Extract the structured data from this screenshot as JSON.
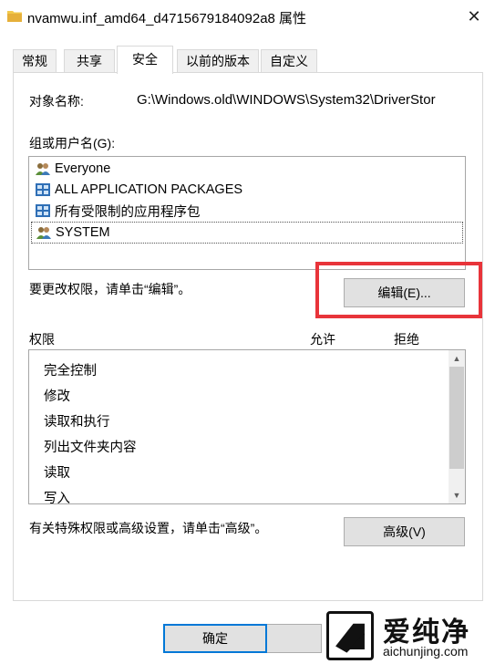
{
  "window": {
    "title": "nvamwu.inf_amd64_d4715679184092a8 属性",
    "close_glyph": "✕"
  },
  "tabs": [
    {
      "label": "常规"
    },
    {
      "label": "共享"
    },
    {
      "label": "安全"
    },
    {
      "label": "以前的版本"
    },
    {
      "label": "自定义"
    }
  ],
  "security": {
    "object_name_label": "对象名称:",
    "object_name_value": "G:\\Windows.old\\WINDOWS\\System32\\DriverStor",
    "group_label": "组或用户名(G):",
    "users": [
      {
        "name": "Everyone",
        "icon": "users-icon"
      },
      {
        "name": "ALL APPLICATION PACKAGES",
        "icon": "package-icon"
      },
      {
        "name": "所有受限制的应用程序包",
        "icon": "package-icon"
      },
      {
        "name": "SYSTEM",
        "icon": "users-icon"
      }
    ],
    "change_hint": "要更改权限，请单击“编辑”。",
    "edit_button": "编辑(E)...",
    "permissions_label": "权限",
    "allow_label": "允许",
    "deny_label": "拒绝",
    "permissions": [
      "完全控制",
      "修改",
      "读取和执行",
      "列出文件夹内容",
      "读取",
      "写入"
    ],
    "advanced_hint": "有关特殊权限或高级设置，请单击“高级”。",
    "advanced_button": "高级(V)"
  },
  "footer": {
    "ok_button": "确定"
  },
  "watermark": {
    "title": "爱纯净",
    "url": "aichunjing.com"
  },
  "colors": {
    "highlight": "#e8343a",
    "button_bg": "#e1e1e1"
  }
}
